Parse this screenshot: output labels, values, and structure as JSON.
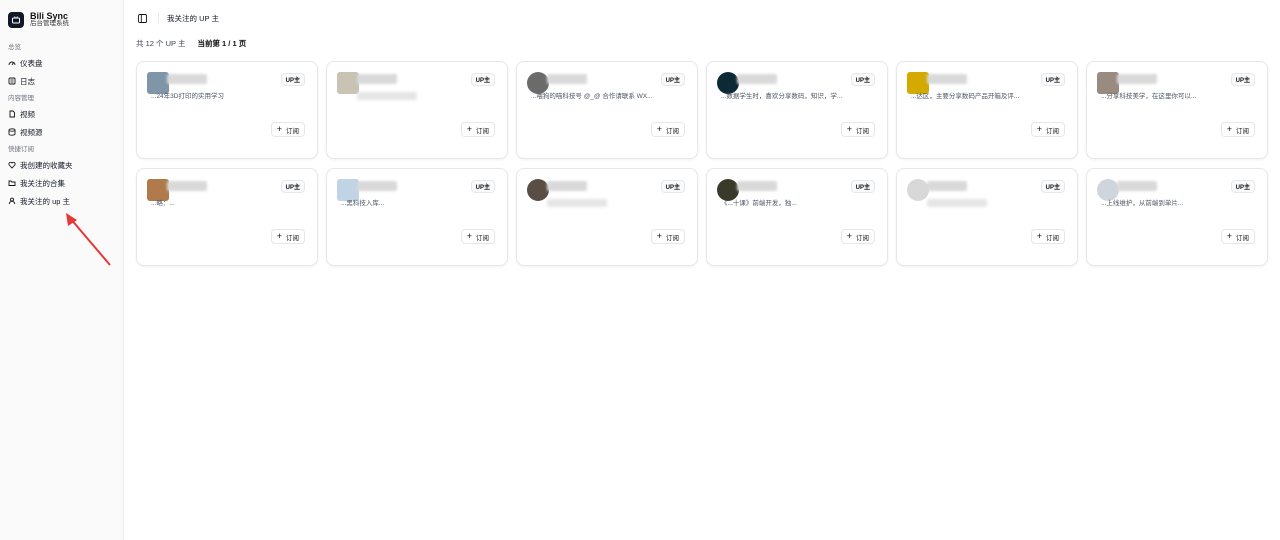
{
  "brand": {
    "title": "Bili Sync",
    "subtitle": "后台管理系统"
  },
  "sidebar": {
    "groups": [
      {
        "label": "总览",
        "items": [
          {
            "label": "仪表盘",
            "icon": "dashboard-icon"
          },
          {
            "label": "日志",
            "icon": "log-icon"
          }
        ]
      },
      {
        "label": "内容管理",
        "items": [
          {
            "label": "视频",
            "icon": "video-icon"
          },
          {
            "label": "视频源",
            "icon": "database-icon"
          }
        ]
      },
      {
        "label": "快捷订阅",
        "items": [
          {
            "label": "我创建的收藏夹",
            "icon": "heart-icon"
          },
          {
            "label": "我关注的合集",
            "icon": "folder-icon"
          },
          {
            "label": "我关注的 up 主",
            "icon": "user-icon"
          }
        ]
      }
    ]
  },
  "header": {
    "breadcrumb": "我关注的 UP 主"
  },
  "summary": {
    "total": "共 12 个 UP 主",
    "page": "当前第 1 / 1 页"
  },
  "badge_label": "UP主",
  "subscribe_label": "订阅",
  "cards": [
    {
      "desc": "...24年3D打印的实用学习",
      "avatar_color": "#7f95a8",
      "round": false
    },
    {
      "desc": "",
      "avatar_color": "#c9c2b5",
      "round": false
    },
    {
      "desc": "...喂狗的喵科技号 @_@ 合作请联系 WX...",
      "avatar_color": "#6b6b6b",
      "round": true
    },
    {
      "desc": "...数据学生时，喜欢分享数码，知识，学...",
      "avatar_color": "#0b2a35",
      "round": true
    },
    {
      "desc": "...达区，主要分享数码产品开箱及评...",
      "avatar_color": "#d4a900",
      "round": false
    },
    {
      "desc": "...分享科技美学，在这里你可以...",
      "avatar_color": "#9a8b80",
      "round": false
    },
    {
      "desc": "...略：...",
      "avatar_color": "#b07a4a",
      "round": false
    },
    {
      "desc": "...黑科技入库...",
      "avatar_color": "#c0d4e6",
      "round": false
    },
    {
      "desc": "",
      "avatar_color": "#5a4e44",
      "round": true
    },
    {
      "desc": "《...十课》前端开发，独...",
      "avatar_color": "#3a3a2a",
      "round": true
    },
    {
      "desc": "",
      "avatar_color": "#d8d8d8",
      "round": true
    },
    {
      "desc": "...上线维护，从前端到单片...",
      "avatar_color": "#cfd5dc",
      "round": true
    }
  ]
}
